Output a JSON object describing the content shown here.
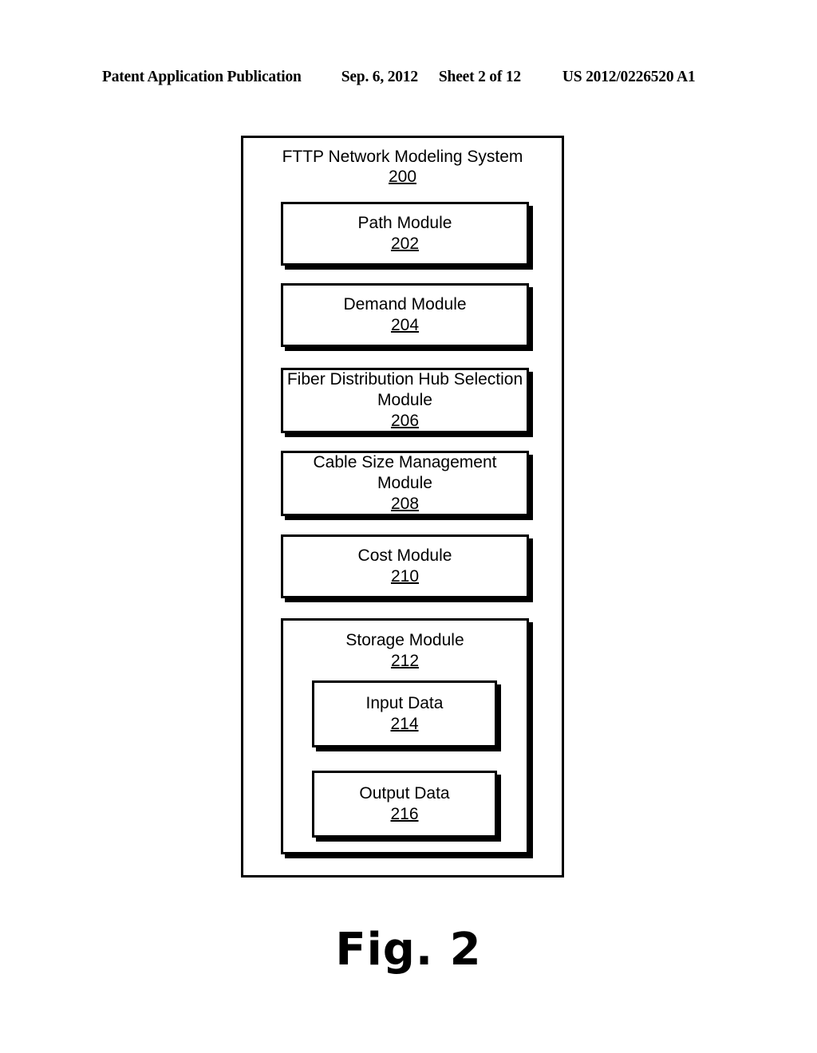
{
  "header": {
    "publication": "Patent Application Publication",
    "date": "Sep. 6, 2012",
    "sheet": "Sheet 2 of 12",
    "pub_number": "US 2012/0226520 A1"
  },
  "figure": {
    "caption": "Fig. 2",
    "system": {
      "title": "FTTP Network Modeling System",
      "ref": "200",
      "modules": [
        {
          "label_line1": "Path Module",
          "ref": "202"
        },
        {
          "label_line1": "Demand Module",
          "ref": "204"
        },
        {
          "label_line1": "Fiber Distribution Hub Selection",
          "label_line2": "Module",
          "ref": "206"
        },
        {
          "label_line1": "Cable Size Management",
          "label_line2": "Module",
          "ref": "208"
        },
        {
          "label_line1": "Cost Module",
          "ref": "210"
        }
      ],
      "storage": {
        "title": "Storage Module",
        "ref": "212",
        "children": [
          {
            "label": "Input Data",
            "ref": "214"
          },
          {
            "label": "Output Data",
            "ref": "216"
          }
        ]
      }
    }
  },
  "colors": {
    "ink": "#000000",
    "paper": "#ffffff"
  }
}
